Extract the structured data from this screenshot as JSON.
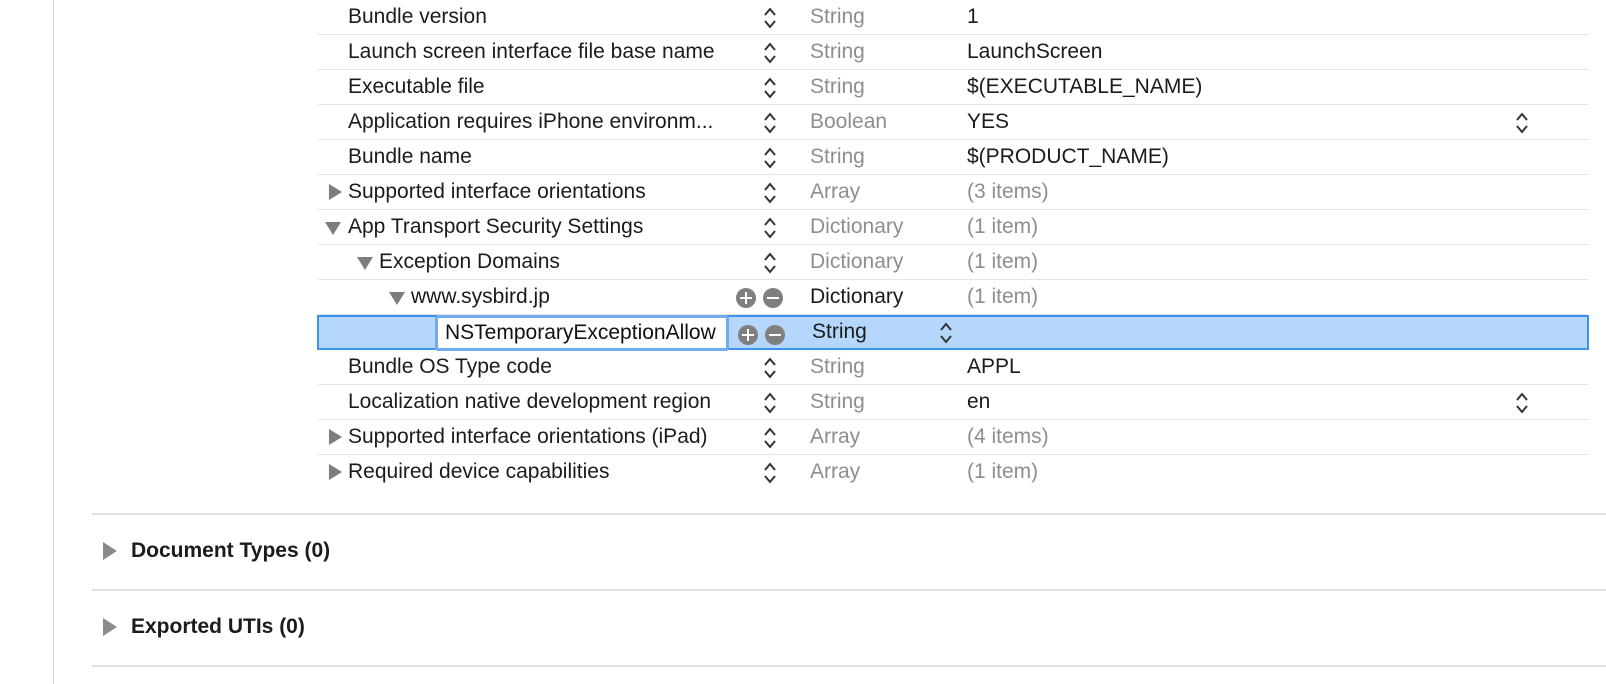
{
  "info_plist": {
    "rows": [
      {
        "key": "Bundle version",
        "type": "String",
        "value": "1"
      },
      {
        "key": "Launch screen interface file base name",
        "type": "String",
        "value": "LaunchScreen"
      },
      {
        "key": "Executable file",
        "type": "String",
        "value": "$(EXECUTABLE_NAME)"
      },
      {
        "key": "Application requires iPhone environm...",
        "type": "Boolean",
        "value": "YES"
      },
      {
        "key": "Bundle name",
        "type": "String",
        "value": "$(PRODUCT_NAME)"
      },
      {
        "key": "Supported interface orientations",
        "type": "Array",
        "value": "(3 items)"
      },
      {
        "key": "App Transport Security Settings",
        "type": "Dictionary",
        "value": "(1 item)"
      },
      {
        "key": "Exception Domains",
        "type": "Dictionary",
        "value": "(1 item)"
      },
      {
        "key": "www.sysbird.jp",
        "type": "Dictionary",
        "value": "(1 item)"
      },
      {
        "key": "NSTemporaryExceptionAllow",
        "type": "String",
        "value": ""
      },
      {
        "key": "Bundle OS Type code",
        "type": "String",
        "value": "APPL"
      },
      {
        "key": "Localization native development region",
        "type": "String",
        "value": "en"
      },
      {
        "key": "Supported interface orientations (iPad)",
        "type": "Array",
        "value": "(4 items)"
      },
      {
        "key": "Required device capabilities",
        "type": "Array",
        "value": "(1 item)"
      }
    ]
  },
  "sections": {
    "document_types": "Document Types (0)",
    "exported_utis": "Exported UTIs (0)"
  },
  "icons": {
    "disclosure_closed": "disclosure-triangle-right-icon",
    "disclosure_open": "disclosure-triangle-down-icon",
    "stepper": "up-down-chevron-icon",
    "add": "plus-circle-icon",
    "remove": "minus-circle-icon"
  },
  "colors": {
    "selection_background": "#b5d7fc",
    "selection_border": "#3d92ee",
    "muted_text": "#8e8e8e"
  }
}
